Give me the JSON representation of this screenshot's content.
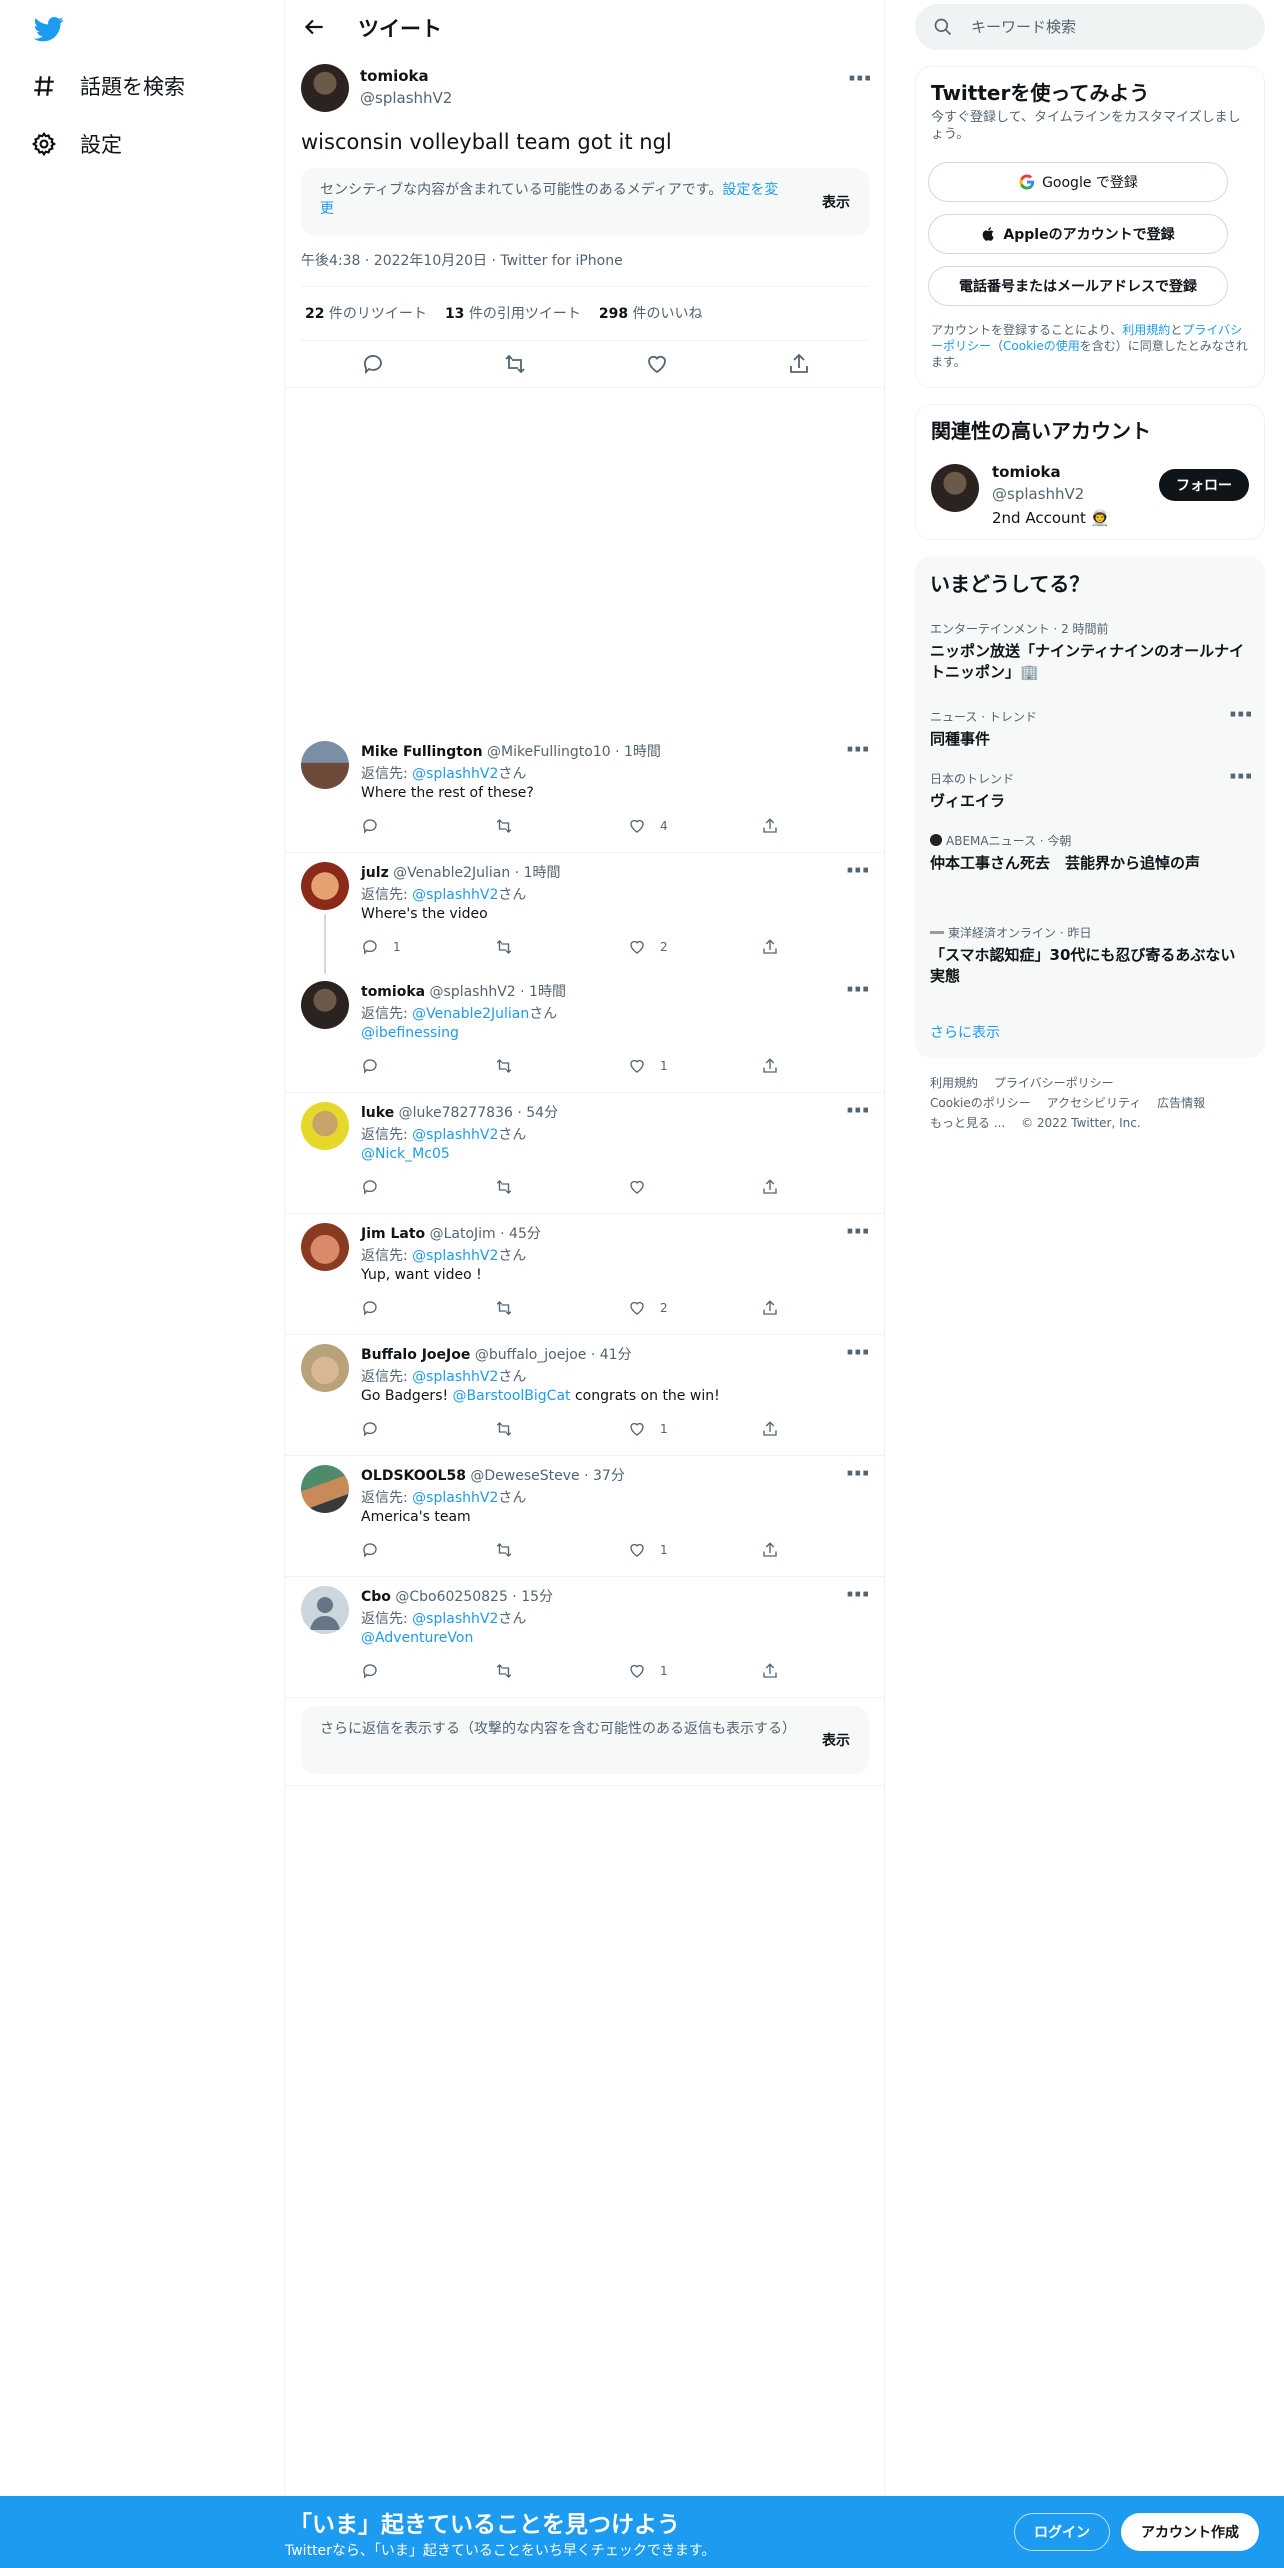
{
  "nav": {
    "explore_label": "話題を検索",
    "settings_label": "設定"
  },
  "header": {
    "title": "ツイート"
  },
  "tweet": {
    "name": "tomioka",
    "handle": "@splashhV2",
    "text": "wisconsin volleyball team got it ngl",
    "sensitive_text": "センシティブな内容が含まれている可能性のあるメディアです。",
    "sensitive_link": "設定を変更",
    "sensitive_show": "表示",
    "meta": "午後4:38 · 2022年10月20日 · Twitter for iPhone",
    "retweets": "22",
    "retweets_label": " 件のリツイート",
    "quotes": "13",
    "quotes_label": " 件の引用ツイート",
    "likes": "298",
    "likes_label": " 件のいいね"
  },
  "replies": [
    {
      "name": "Mike Fullington",
      "handle": "@MikeFullingto10 · 1時間",
      "reply_to_prefix": "返信先: ",
      "reply_to": "@splashhV2",
      "reply_to_suffix": "さん",
      "text": "Where the rest of these?",
      "text_link": "",
      "replies": "",
      "likes": "4"
    },
    {
      "name": "julz",
      "handle": "@Venable2Julian · 1時間",
      "reply_to_prefix": "返信先: ",
      "reply_to": "@splashhV2",
      "reply_to_suffix": "さん",
      "text": "Where's the video",
      "text_link": "",
      "replies": "1",
      "likes": "2"
    },
    {
      "name": "tomioka",
      "handle": "@splashhV2 · 1時間",
      "reply_to_prefix": "返信先: ",
      "reply_to": "@Venable2Julian",
      "reply_to_suffix": "さん",
      "text": "",
      "text_link": "@ibefinessing",
      "replies": "",
      "likes": "1"
    },
    {
      "name": "luke",
      "handle": "@luke78277836 · 54分",
      "reply_to_prefix": "返信先: ",
      "reply_to": "@splashhV2",
      "reply_to_suffix": "さん",
      "text": "",
      "text_link": "@Nick_Mc05",
      "replies": "",
      "likes": ""
    },
    {
      "name": "Jim Lato",
      "handle": "@LatoJim · 45分",
      "reply_to_prefix": "返信先: ",
      "reply_to": "@splashhV2",
      "reply_to_suffix": "さん",
      "text": "Yup, want video !",
      "text_link": "",
      "replies": "",
      "likes": "2"
    },
    {
      "name": "Buffalo JoeJoe",
      "handle": "@buffalo_joejoe · 41分",
      "reply_to_prefix": "返信先: ",
      "reply_to": "@splashhV2",
      "reply_to_suffix": "さん",
      "text_pre": "Go Badgers! ",
      "text_link": "@BarstoolBigCat",
      "text_post": " congrats on the win!",
      "replies": "",
      "likes": "1"
    },
    {
      "name": "OLDSKOOL58",
      "handle": "@DeweseSteve · 37分",
      "reply_to_prefix": "返信先: ",
      "reply_to": "@splashhV2",
      "reply_to_suffix": "さん",
      "text": "America's team",
      "text_link": "",
      "replies": "",
      "likes": "1"
    },
    {
      "name": "Cbo",
      "handle": "@Cbo60250825 · 15分",
      "reply_to_prefix": "返信先: ",
      "reply_to": "@splashhV2",
      "reply_to_suffix": "さん",
      "text": "",
      "text_link": "@AdventureVon",
      "replies": "",
      "likes": "1"
    }
  ],
  "more_replies": {
    "text": "さらに返信を表示する（攻撃的な内容を含む可能性のある返信も表示する）",
    "show": "表示"
  },
  "search": {
    "placeholder": "キーワード検索"
  },
  "signup": {
    "title": "Twitterを使ってみよう",
    "desc": "今すぐ登録して、タイムラインをカスタマイズしましょう。",
    "google": "Google で登録",
    "apple": "Appleのアカウントで登録",
    "phone": "電話番号またはメールアドレスで登録",
    "terms_1": "アカウントを登録することにより、",
    "terms_tos": "利用規約",
    "terms_2": "と",
    "terms_pp": "プライバシーポリシー",
    "terms_3": "（",
    "terms_cookie": "Cookieの使用",
    "terms_4": "を含む）に同意したとみなされます。"
  },
  "relevant": {
    "title": "関連性の高いアカウント",
    "name": "tomioka",
    "handle": "@splashhV2",
    "bio": "2nd Account 👨‍🚀",
    "follow": "フォロー"
  },
  "trends": {
    "title": "いまどうしてる？",
    "items": [
      {
        "category": "エンターテインメント · 2 時間前",
        "title": "ニッポン放送「ナインティナインのオールナイトニッポン」🏢"
      },
      {
        "category": "ニュース · トレンド",
        "title": "同種事件"
      },
      {
        "category": "日本のトレンド",
        "title": "ヴィエイラ"
      },
      {
        "category": "ABEMAニュース · 今朝",
        "title": "仲本工事さん死去　芸能界から追悼の声"
      },
      {
        "category": "東洋経済オンライン · 昨日",
        "title": "「スマホ認知症」30代にも忍び寄るあぶない実態"
      }
    ],
    "show_more": "さらに表示"
  },
  "footer": {
    "links": [
      "利用規約",
      "プライバシーポリシー",
      "Cookieのポリシー",
      "アクセシビリティ",
      "広告情報",
      "もっと見る ..."
    ],
    "copyright": "© 2022 Twitter, Inc."
  },
  "bottom_bar": {
    "headline": "「いま」起きていることを見つけよう",
    "sub": "Twitterなら、「いま」起きていることをいち早くチェックできます。",
    "login": "ログイン",
    "signup": "アカウント作成"
  },
  "colors": {
    "accent": "#1d9bf0",
    "text": "#0f1419",
    "muted": "#536471",
    "border": "#eff3f4"
  }
}
